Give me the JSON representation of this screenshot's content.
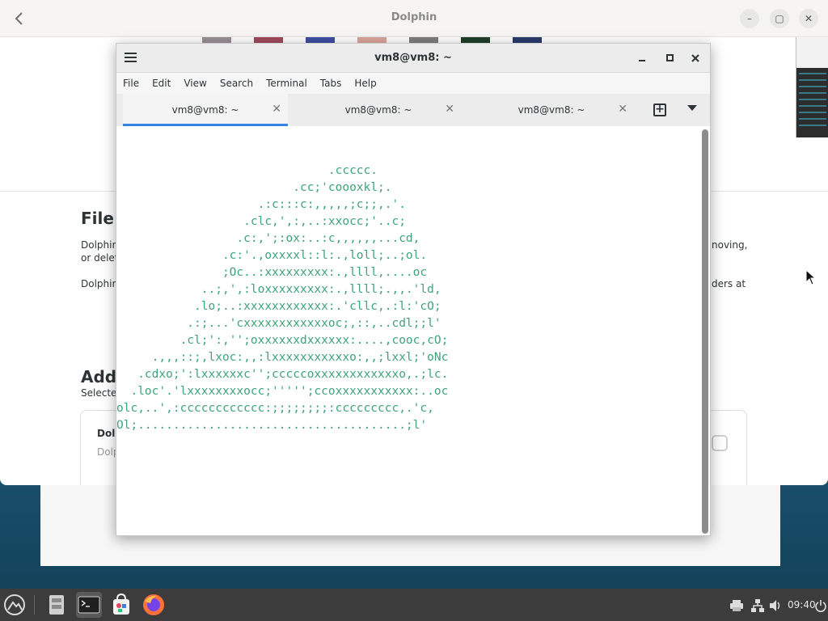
{
  "dolphin": {
    "title": "Dolphin",
    "back_icon": "chevron-left-icon",
    "controls": {
      "minimize": "–",
      "maximize": "▢",
      "close": "✕"
    },
    "section_title": "File Manager",
    "section_title_visible": "File",
    "para1_left": "Dolphin",
    "para1_left_line2": "or delet",
    "para1_right": "noving,",
    "para2_left": "Dolphin",
    "para2_right": "ders at",
    "addons_title": "Add-",
    "addons_sub": "Selecte",
    "addon_name": "Dolp",
    "addon_desc": "Dolp"
  },
  "terminal": {
    "title": "vm8@vm8: ~",
    "menu": [
      "File",
      "Edit",
      "View",
      "Search",
      "Terminal",
      "Tabs",
      "Help"
    ],
    "tabs": [
      {
        "label": "vm8@vm8: ~",
        "active": true
      },
      {
        "label": "vm8@vm8: ~",
        "active": false
      },
      {
        "label": "vm8@vm8: ~",
        "active": false
      }
    ],
    "tab_close_glyph": "✕",
    "ascii_color": "#3fa37a",
    "ascii_art": [
      "                              .ccccc.",
      "                         .cc;'coooxkl;.",
      "                    .:c:::c:,,,,,;c;;,.'.",
      "                  .clc,',:,..:xxocc;'..c;",
      "                 .c:,';:ox:..:c,,,,,,...cd,",
      "               .c:'.,oxxxxl::l:.,loll;..;ol.",
      "               ;Oc..:xxxxxxxxx:.,llll,....oc",
      "            ..;,',:loxxxxxxxxx:.,llll;.,,.'ld,",
      "           .lo;..:xxxxxxxxxxxx:.'cllc,.:l:'cO;",
      "          .:;...'cxxxxxxxxxxxxoc;,::,..cdl;;l'",
      "         .cl;':,'';oxxxxxxdxxxxxx:....,cooc,cO;",
      "     .,,,::;,lxoc:,,:lxxxxxxxxxxxo:,,;lxxl;'oNc",
      "   .cdxo;':lxxxxxxc'';cccccoxxxxxxxxxxxxo,.;lc.",
      "  .loc'.'lxxxxxxxxocc;''''';ccoxxxxxxxxxxx:..oc",
      "olc,..',:cccccccccccc:;;;;;;;;:ccccccccc,.'c,",
      "Ol;......................................;l'"
    ]
  },
  "taskbar": {
    "apps": [
      {
        "name": "launcher",
        "icon": "system-menu-icon"
      },
      {
        "name": "files",
        "icon": "file-cabinet-icon"
      },
      {
        "name": "terminal",
        "icon": "terminal-icon",
        "active": true
      },
      {
        "name": "software",
        "icon": "store-bag-icon"
      },
      {
        "name": "firefox",
        "icon": "firefox-icon"
      }
    ],
    "clock": "09:40",
    "tray_icons": [
      "printer-icon",
      "network-icon",
      "volume-icon",
      "power-icon"
    ]
  },
  "colors": {
    "accent": "#3584e4",
    "taskbar": "#3c3c3c",
    "ascii": "#3fa37a"
  }
}
